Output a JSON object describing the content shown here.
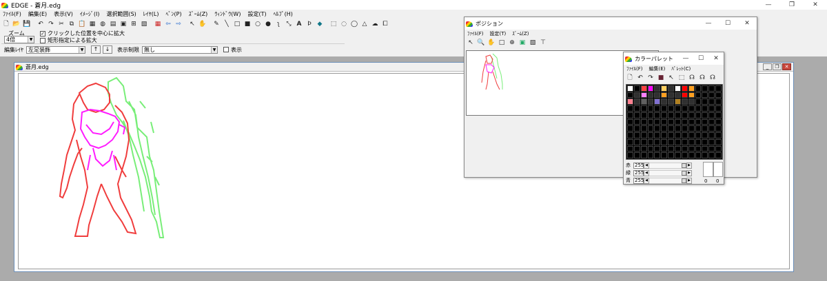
{
  "app": {
    "title": "EDGE - 蒼月.edg",
    "controls": {
      "minimize": "—",
      "maximize": "❐",
      "close": "✕"
    }
  },
  "menu": [
    "ﾌｧｲﾙ(F)",
    "編集(E)",
    "表示(V)",
    "ｲﾒｰｼﾞ(I)",
    "選択範囲(S)",
    "ﾚｲﾔ(L)",
    "ﾍﾟﾝ(P)",
    "ｽﾞｰﾑ(Z)",
    "ｳｨﾝﾄﾞｳ(W)",
    "設定(T)",
    "ﾍﾙﾌﾟ(H)"
  ],
  "toolbar_icons": [
    "new-file",
    "open-folder",
    "save",
    "undo",
    "redo",
    "cut",
    "copy",
    "paste",
    "layer",
    "palette",
    "preview",
    "grid",
    "rect-select",
    "move",
    "hand",
    "pen",
    "line",
    "rect",
    "fill-rect",
    "ellipse",
    "fill-ellipse",
    "spray",
    "dropper",
    "text",
    "fill",
    "lasso"
  ],
  "zoom": {
    "label": "ズーム",
    "value": "4倍",
    "option1": {
      "checked": true,
      "label": "クリックした位置を中心に拡大"
    },
    "option2": {
      "checked": false,
      "label": "矩形指定による拡大"
    }
  },
  "layer": {
    "label": "編集ﾚｲﾔ",
    "value": "左足装飾",
    "up": "↑",
    "down": "↓",
    "limit_label": "表示制限",
    "limit_value": "無し",
    "show_label": "表示"
  },
  "document": {
    "title": "蒼月.edg"
  },
  "position_window": {
    "title": "ポジション",
    "menu": [
      "ﾌｧｲﾙ(F)",
      "設定(T)",
      "ｽﾞｰﾑ(Z)"
    ]
  },
  "palette_window": {
    "title": "カラーパレット",
    "menu": [
      "ﾌｧｲﾙ(F)",
      "編集(E)",
      "ﾊﾟﾚｯﾄ(C)"
    ],
    "red_label": "赤",
    "red_value": "255",
    "green_label": "緑",
    "green_value": "255",
    "blue_label": "青",
    "blue_value": "255",
    "index_left": "0",
    "index_right": "0",
    "colors": [
      "#ffffff",
      "#000000",
      "#ff4040",
      "#ff00ff",
      "#ff80ff",
      "#303030",
      "#303030",
      "#ffd060",
      "#ffffff",
      "#ff0000",
      "#ffa020"
    ]
  },
  "colors": {
    "red_line": "#f03c3c",
    "magenta_line": "#ff1cff",
    "green_line": "#78ee78"
  }
}
